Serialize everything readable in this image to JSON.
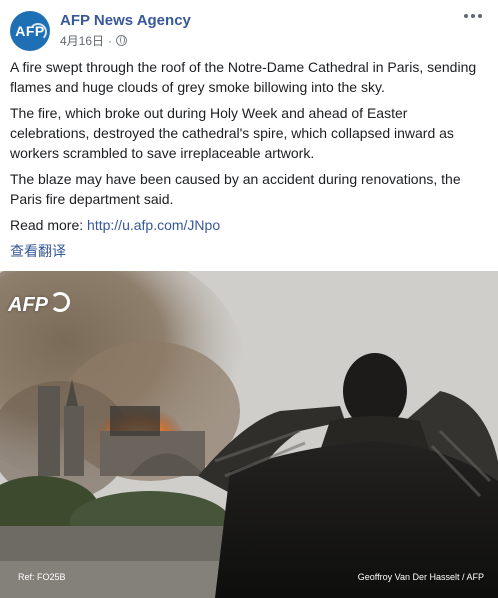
{
  "post": {
    "author": "AFP News Agency",
    "avatar_text": "AFP",
    "date": "4月16日",
    "separator": "·",
    "paragraphs": [
      "A fire swept through the roof of the Notre-Dame Cathedral in Paris, sending flames and huge clouds of grey smoke billowing into the sky.",
      "The fire, which broke out during Holy Week and ahead of Easter celebrations, destroyed the cathedral's spire, which collapsed inward as workers scrambled to save irreplaceable artwork.",
      "The blaze may have been caused by an accident during renovations, the Paris fire department said."
    ],
    "read_more_label": "Read more:",
    "read_more_link": "http://u.afp.com/JNpo",
    "translate_label": "查看翻译"
  },
  "photo": {
    "watermark": "AFP",
    "ref": "Ref: FO25B",
    "credit": "Geoffroy Van Der Hasselt / AFP"
  },
  "icons": {
    "privacy": "globe-icon",
    "options": "more-options-icon"
  },
  "colors": {
    "link": "#385898",
    "avatar": "#1f6fb5",
    "meta": "#616770"
  }
}
